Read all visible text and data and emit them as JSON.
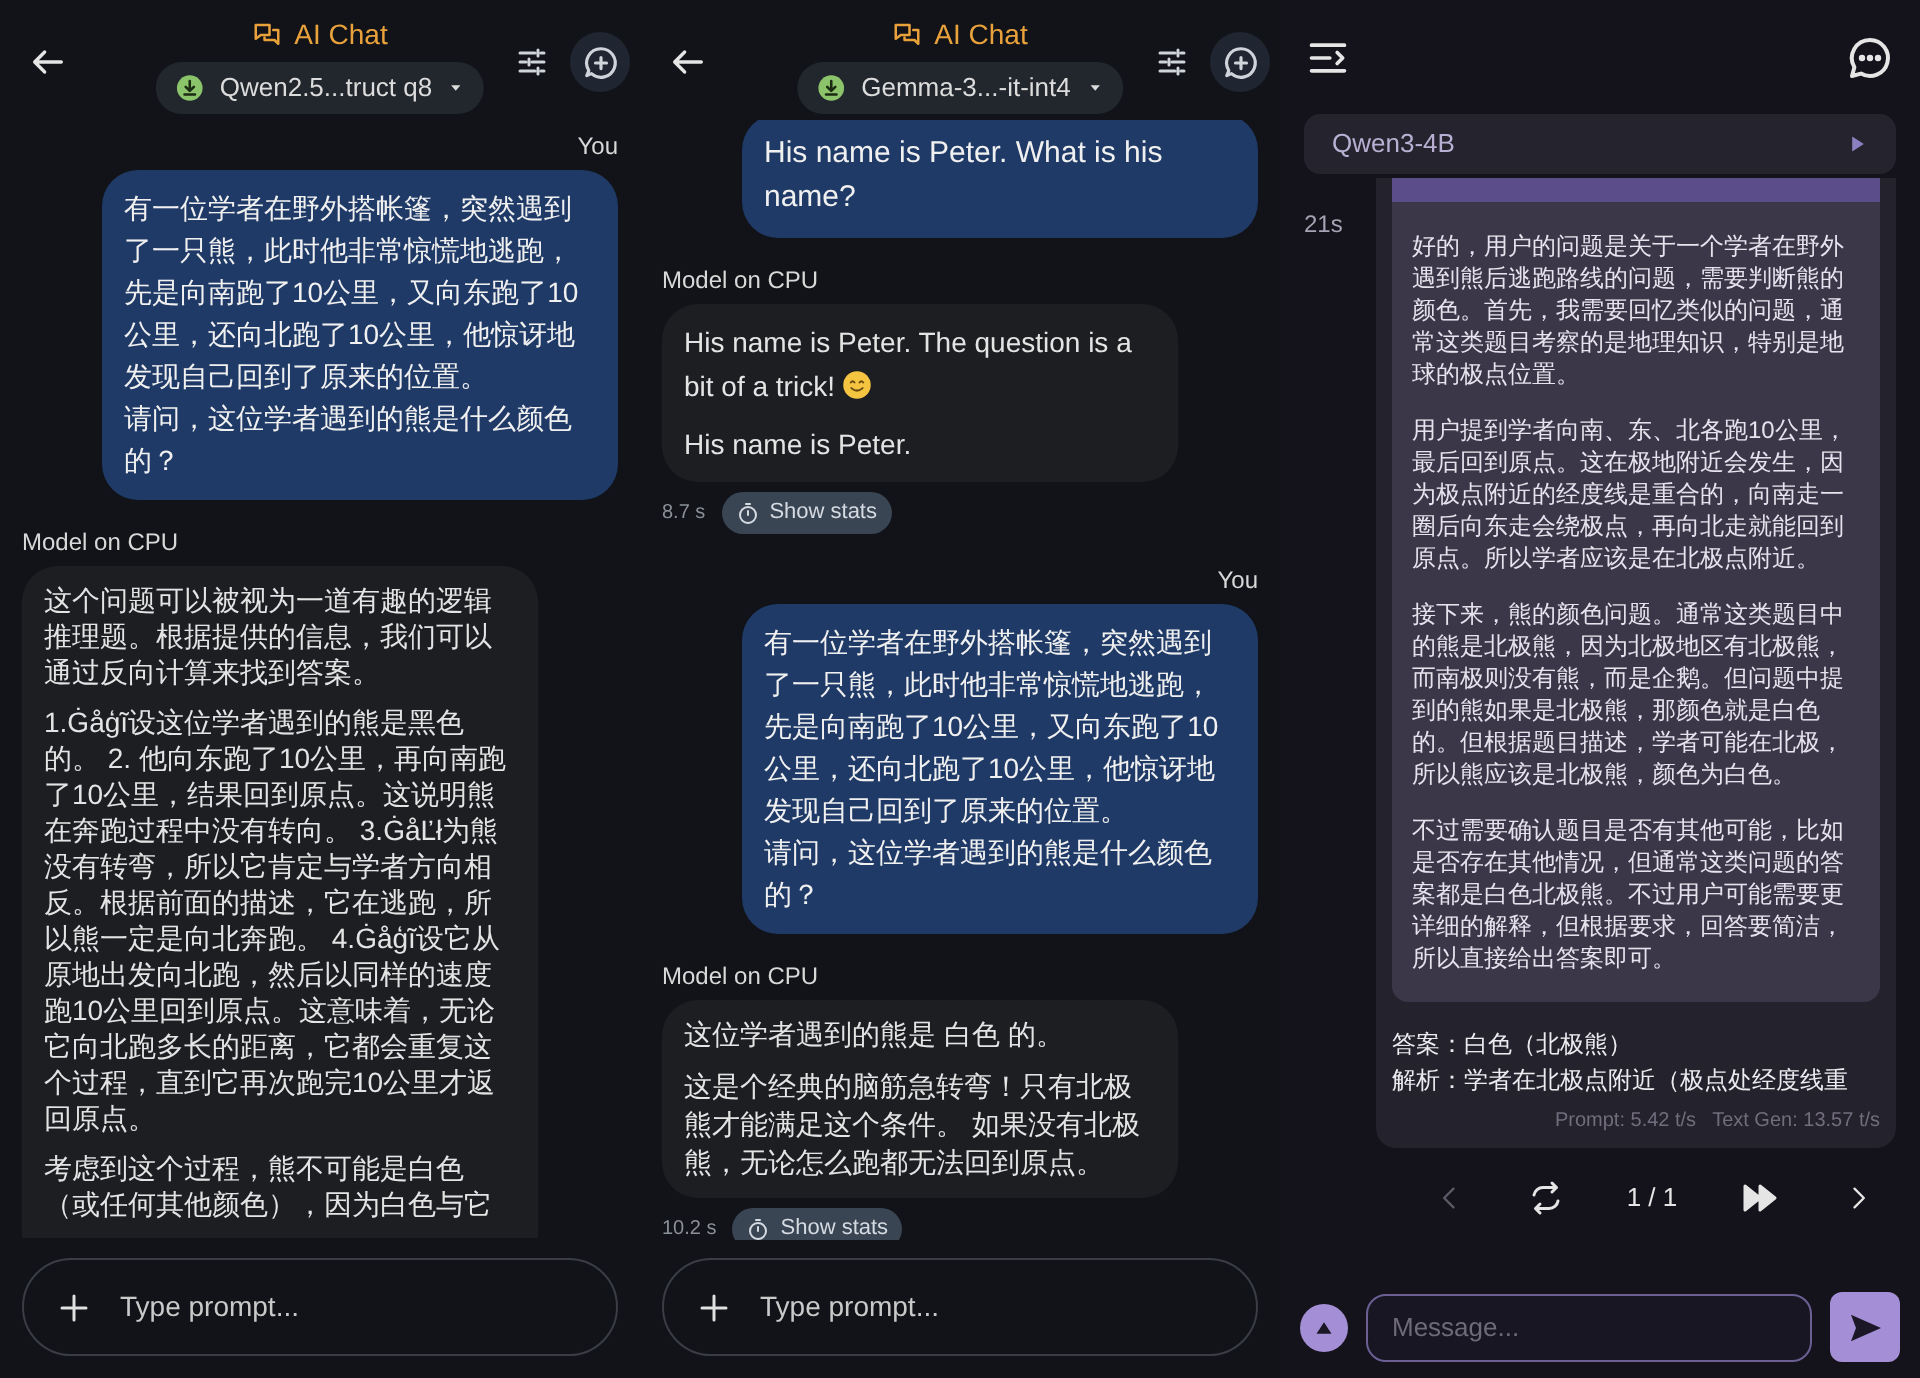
{
  "panels": [
    {
      "kind": "chat",
      "title": "AI Chat",
      "model": "Qwen2.5...truct q8",
      "messages": [
        {
          "kind": "user",
          "label": "You",
          "paragraphs": [
            {
              "text": "有一位学者在野外搭帐篷，突然遇到了一只熊，此时他非常惊慌地逃跑，先是向南跑了10公里，又向东跑了10公里，还向北跑了10公里，他惊讶地发现自己回到了原来的位置。"
            },
            {
              "text": "请问，这位学者遇到的熊是什么颜色的？"
            }
          ]
        },
        {
          "kind": "model",
          "label": "Model on CPU",
          "cut": true,
          "paragraphs": [
            {
              "text": "这个问题可以被视为一道有趣的逻辑推理题。根据提供的信息，我们可以通过反向计算来找到答案。"
            },
            {
              "text": "1.Ġåģĩ设这位学者遇到的熊是黑色的。 2. 他向东跑了10公里，再向南跑了10公里，结果回到原点。这说明熊在奔跑过程中没有转向。 3.ĠåĽł为熊没有转弯，所以它肯定与学者方向相反。根据前面的描述，它在逃跑，所以熊一定是向北奔跑。 4.Ġåģĩ设它从原地出发向北跑，然后以同样的速度跑10公里回到原点。这意味着，无论它向北跑多长的距离，它都会重复这个过程，直到它再次跑完10公里才返回原点。"
            },
            {
              "text": "考虑到这个过程，熊不可能是白色（或任何其他颜色），因为白色与它"
            }
          ]
        }
      ],
      "placeholder": "Type prompt..."
    },
    {
      "kind": "chat",
      "title": "AI Chat",
      "model": "Gemma-3...-it-int4",
      "messages": [
        {
          "kind": "user",
          "paragraphs": [
            {
              "text": "His name is Peter. What is his name?"
            }
          ]
        },
        {
          "kind": "model",
          "label": "Model on CPU",
          "time": "8.7 s",
          "stats_button": "Show stats",
          "paragraphs": [
            {
              "text": "His name is Peter. The question is a bit of a trick!",
              "smiley": true
            },
            {
              "text": "His name is Peter."
            }
          ]
        },
        {
          "kind": "user",
          "label": "You",
          "paragraphs": [
            {
              "text": "有一位学者在野外搭帐篷，突然遇到了一只熊，此时他非常惊慌地逃跑，先是向南跑了10公里，又向东跑了10公里，还向北跑了10公里，他惊讶地发现自己回到了原来的位置。"
            },
            {
              "text": "请问，这位学者遇到的熊是什么颜色的？"
            }
          ]
        },
        {
          "kind": "model",
          "label": "Model on CPU",
          "time": "10.2 s",
          "stats_button": "Show stats",
          "paragraphs": [
            {
              "text": "这位学者遇到的熊是 白色 的。"
            },
            {
              "text": "这是个经典的脑筋急转弯！只有北极熊才能满足这个条件。 如果没有北极熊，无论怎么跑都无法回到原点。"
            }
          ]
        }
      ],
      "placeholder": "Type prompt..."
    },
    {
      "kind": "reasoning",
      "model": "Qwen3-4B",
      "elapsed": "21s",
      "thought": [
        "好的，用户的问题是关于一个学者在野外遇到熊后逃跑路线的问题，需要判断熊的颜色。首先，我需要回忆类似的问题，通常这类题目考察的是地理知识，特别是地球的极点位置。",
        "用户提到学者向南、东、北各跑10公里，最后回到原点。这在极地附近会发生，因为极点附近的经度线是重合的，向南走一圈后向东走会绕极点，再向北走就能回到原点。所以学者应该是在北极点附近。",
        "接下来，熊的颜色问题。通常这类题目中的熊是北极熊，因为北极地区有北极熊，而南极则没有熊，而是企鹅。但问题中提到的熊如果是北极熊，那颜色就是白色的。但根据题目描述，学者可能在北极，所以熊应该是北极熊，颜色为白色。",
        "不过需要确认题目是否有其他可能，比如是否存在其他情况，但通常这类问题的答案都是白色北极熊。不过用户可能需要更详细的解释，但根据要求，回答要简洁，所以直接给出答案即可。"
      ],
      "answer": [
        "答案：白色（北极熊）",
        "解析：学者在北极点附近（极点处经度线重"
      ],
      "prompt_speed": "Prompt: 5.42 t/s",
      "gen_speed": "Text Gen: 13.57 t/s",
      "prev_disabled": true,
      "page": "1 / 1",
      "placeholder": "Message..."
    }
  ]
}
